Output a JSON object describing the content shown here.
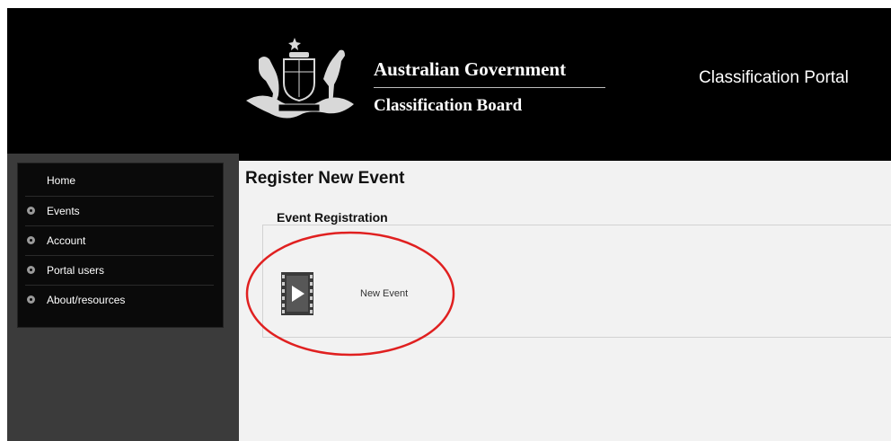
{
  "header": {
    "gov_title": "Australian Government",
    "gov_subtitle": "Classification Board",
    "portal_title": "Classification Portal"
  },
  "sidebar": {
    "items": [
      {
        "label": "Home",
        "has_bullet": false
      },
      {
        "label": "Events",
        "has_bullet": true
      },
      {
        "label": "Account",
        "has_bullet": true
      },
      {
        "label": "Portal users",
        "has_bullet": true
      },
      {
        "label": "About/resources",
        "has_bullet": true
      }
    ]
  },
  "main": {
    "page_title": "Register New Event",
    "section_title": "Event Registration",
    "tile_label": "New Event"
  },
  "colors": {
    "header_bg": "#000000",
    "sidebar_bg": "#3b3b3b",
    "content_bg": "#f2f2f2",
    "annotation": "#e02020"
  },
  "icons": {
    "crest": "coat-of-arms-icon",
    "tile": "film-play-icon",
    "bullet": "plus-circle-icon"
  }
}
